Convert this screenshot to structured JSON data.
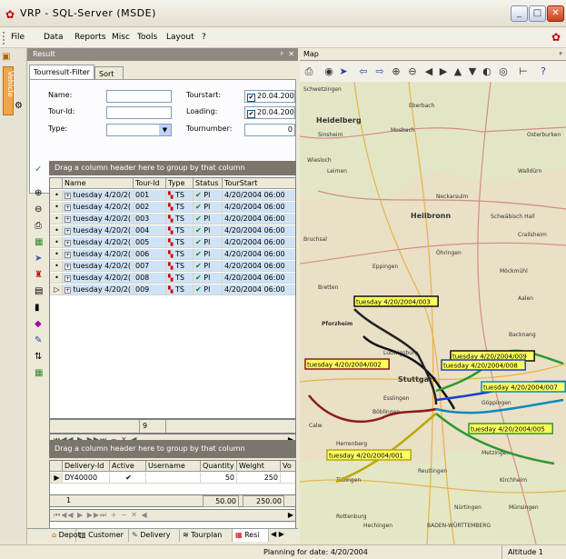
{
  "window": {
    "title": "VRP - SQL-Server (MSDE)",
    "minimize_label": "_",
    "maximize_label": "□",
    "close_label": "✕"
  },
  "menu": {
    "items": [
      "File",
      "Data",
      "Reports",
      "Misc",
      "Tools",
      "Layout",
      "?"
    ]
  },
  "left_toolbar": {
    "vehicle_tab": "Vehicle"
  },
  "result_panel": {
    "header": "Result",
    "pin": "ᵖ",
    "close": "✕",
    "tabs": [
      "Tourresult-Filter",
      "Sort"
    ],
    "filter": {
      "name_label": "Name:",
      "tourid_label": "Tour-Id:",
      "type_label": "Type:",
      "tourstart_label": "Tourstart:",
      "loading_label": "Loading:",
      "tournumber_label": "Tournumber:",
      "tourstart_value": "20.04.2004",
      "loading_value": "20.04.2004",
      "tournumber_value": "0",
      "name_value": "",
      "tourid_value": "",
      "type_value": ""
    },
    "grid_group_hint": "Drag a column header here to group by that column",
    "grid_columns": [
      "",
      "Name",
      "Tour-Id",
      "Type",
      "Status",
      "TourStart"
    ],
    "grid_rows": [
      {
        "name": "tuesday 4/20/2(",
        "id": "001",
        "type": "TS",
        "status": "Pl",
        "start": "4/20/2004 06:00"
      },
      {
        "name": "tuesday 4/20/2(",
        "id": "002",
        "type": "TS",
        "status": "Pl",
        "start": "4/20/2004 06:00"
      },
      {
        "name": "tuesday 4/20/2(",
        "id": "003",
        "type": "TS",
        "status": "Pl",
        "start": "4/20/2004 06:00"
      },
      {
        "name": "tuesday 4/20/2(",
        "id": "004",
        "type": "TS",
        "status": "Pl",
        "start": "4/20/2004 06:00"
      },
      {
        "name": "tuesday 4/20/2(",
        "id": "005",
        "type": "TS",
        "status": "Pl",
        "start": "4/20/2004 06:00"
      },
      {
        "name": "tuesday 4/20/2(",
        "id": "006",
        "type": "TS",
        "status": "Pl",
        "start": "4/20/2004 06:00"
      },
      {
        "name": "tuesday 4/20/2(",
        "id": "007",
        "type": "TS",
        "status": "Pl",
        "start": "4/20/2004 06:00"
      },
      {
        "name": "tuesday 4/20/2(",
        "id": "008",
        "type": "TS",
        "status": "Pl",
        "start": "4/20/2004 06:00"
      },
      {
        "name": "tuesday 4/20/2(",
        "id": "009",
        "type": "TS",
        "status": "Pl",
        "start": "4/20/2004 06:00"
      }
    ],
    "grid_count": "9",
    "grid2_group_hint": "Drag a column header here to group by that column",
    "grid2_columns": [
      "",
      "Delivery-Id",
      "Active",
      "Username",
      "Quantity",
      "Weight",
      "Vo"
    ],
    "grid2_rows": [
      {
        "id": "DY40000",
        "active": "✔",
        "username": "",
        "quantity": "50",
        "weight": "250"
      }
    ],
    "grid2_footer": {
      "count": "1",
      "quantity_total": "50.00",
      "weight_total": "250.00"
    }
  },
  "bottom_tabs": [
    "Depot",
    "Customer",
    "Delivery",
    "Tourplan",
    "Resi"
  ],
  "status": {
    "planning": "Planning for date: 4/20/2004",
    "altitude": "Altitude 1"
  },
  "map": {
    "header": "Map",
    "pin": "ᵖ",
    "labels": [
      "tuesday 4/20/2004/003",
      "tuesday 4/20/2004/009",
      "tuesday 4/20/2004/008",
      "tuesday 4/20/2004/002",
      "tuesday 4/20/2004/007",
      "tuesday 4/20/2004/005",
      "tuesday 4/20/2004/001"
    ],
    "towns": [
      "Schwetzingen",
      "Heidelberg",
      "Mosbach",
      "Heilbronn",
      "Neckarsulm",
      "Bretten",
      "Pforzheim",
      "Stuttgart",
      "Esslingen",
      "Göppingen",
      "Reutlingen",
      "Tübingen",
      "Böblingen",
      "Ludwigsburg",
      "Waiblingen",
      "Backnang",
      "Schwäbisch Hall",
      "Crailsheim",
      "Aalen",
      "Rottenburg",
      "Nürtingen",
      "Kirchheim",
      "Hechingen",
      "BADEN-WÜRTTEMBERG",
      "Sinsheim",
      "Eberbach",
      "Wiesloch",
      "Leimen",
      "Walldürn",
      "Osterburken",
      "Möckmühl",
      "Öhringen",
      "Eppingen",
      "Bruchsal",
      "Calw",
      "Herrenberg",
      "Metzingen",
      "Münsingen"
    ]
  }
}
